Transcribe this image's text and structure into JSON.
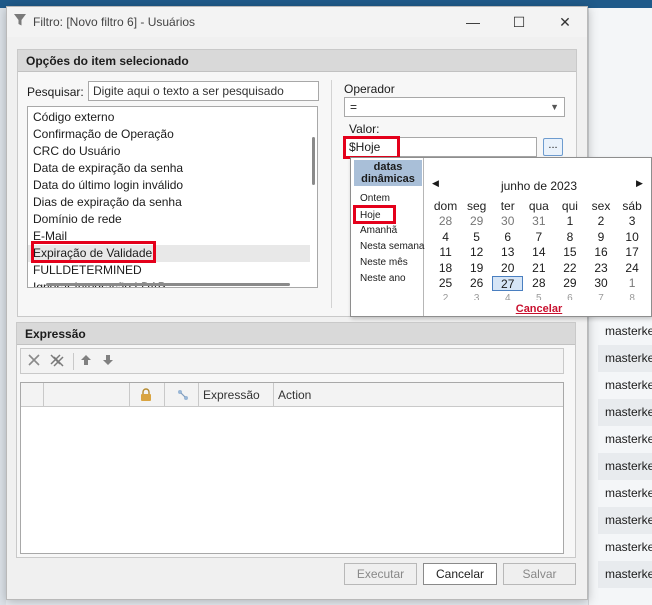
{
  "dialog": {
    "title": "Filtro: [Novo filtro 6] - Usuários",
    "minimize": "—",
    "maximize": "☐",
    "close": "✕"
  },
  "options_panel": {
    "header": "Opções do item selecionado",
    "search_label": "Pesquisar:",
    "search_placeholder": "Digite aqui o texto a ser pesquisado",
    "fields": [
      "Código externo",
      "Confirmação de Operação",
      "CRC do Usuário",
      "Data de expiração da senha",
      "Data do último login inválido",
      "Dias de expiração da senha",
      "Domínio de rede",
      "E-Mail",
      "Expiração de Validade",
      "FULLDETERMINED",
      "Ignorar Integração LDAP"
    ],
    "selected_field": "Expiração de Validade",
    "operator_label": "Operador",
    "operator_value": "=",
    "value_label": "Valor:",
    "value": "$Hoje",
    "ellipsis": "..."
  },
  "dynamic_dates": {
    "header": "datas dinâmicas",
    "items": [
      "Ontem",
      "Hoje",
      "Amanhã",
      "Nesta semana",
      "Neste mês",
      "Neste ano"
    ]
  },
  "calendar": {
    "month_title": "junho de 2023",
    "prev": "◀",
    "next": "▶",
    "weekdays": [
      "dom",
      "seg",
      "ter",
      "qua",
      "qui",
      "sex",
      "sáb"
    ],
    "weeks": [
      [
        "28",
        "29",
        "30",
        "31",
        "1",
        "2",
        "3"
      ],
      [
        "4",
        "5",
        "6",
        "7",
        "8",
        "9",
        "10"
      ],
      [
        "11",
        "12",
        "13",
        "14",
        "15",
        "16",
        "17"
      ],
      [
        "18",
        "19",
        "20",
        "21",
        "22",
        "23",
        "24"
      ],
      [
        "25",
        "26",
        "27",
        "28",
        "29",
        "30",
        "1"
      ],
      [
        "2",
        "3",
        "4",
        "5",
        "6",
        "7",
        "8"
      ]
    ],
    "today": "27",
    "cancel": "Cancelar"
  },
  "expression_panel": {
    "header": "Expressão",
    "columns": [
      "",
      "",
      "",
      "Expressão",
      "Action"
    ]
  },
  "buttons": {
    "execute": "Executar",
    "cancel": "Cancelar",
    "save": "Salvar"
  },
  "background": {
    "rows": [
      "masterkey",
      "masterkey",
      "masterkey",
      "masterkey",
      "masterkey",
      "masterkey",
      "masterkey",
      "masterkey",
      "masterkey",
      "masterkey"
    ]
  },
  "colors": {
    "highlight": "#e4001b",
    "dyn_header": "#a9bfd8",
    "cancel_link": "#c8102e"
  }
}
